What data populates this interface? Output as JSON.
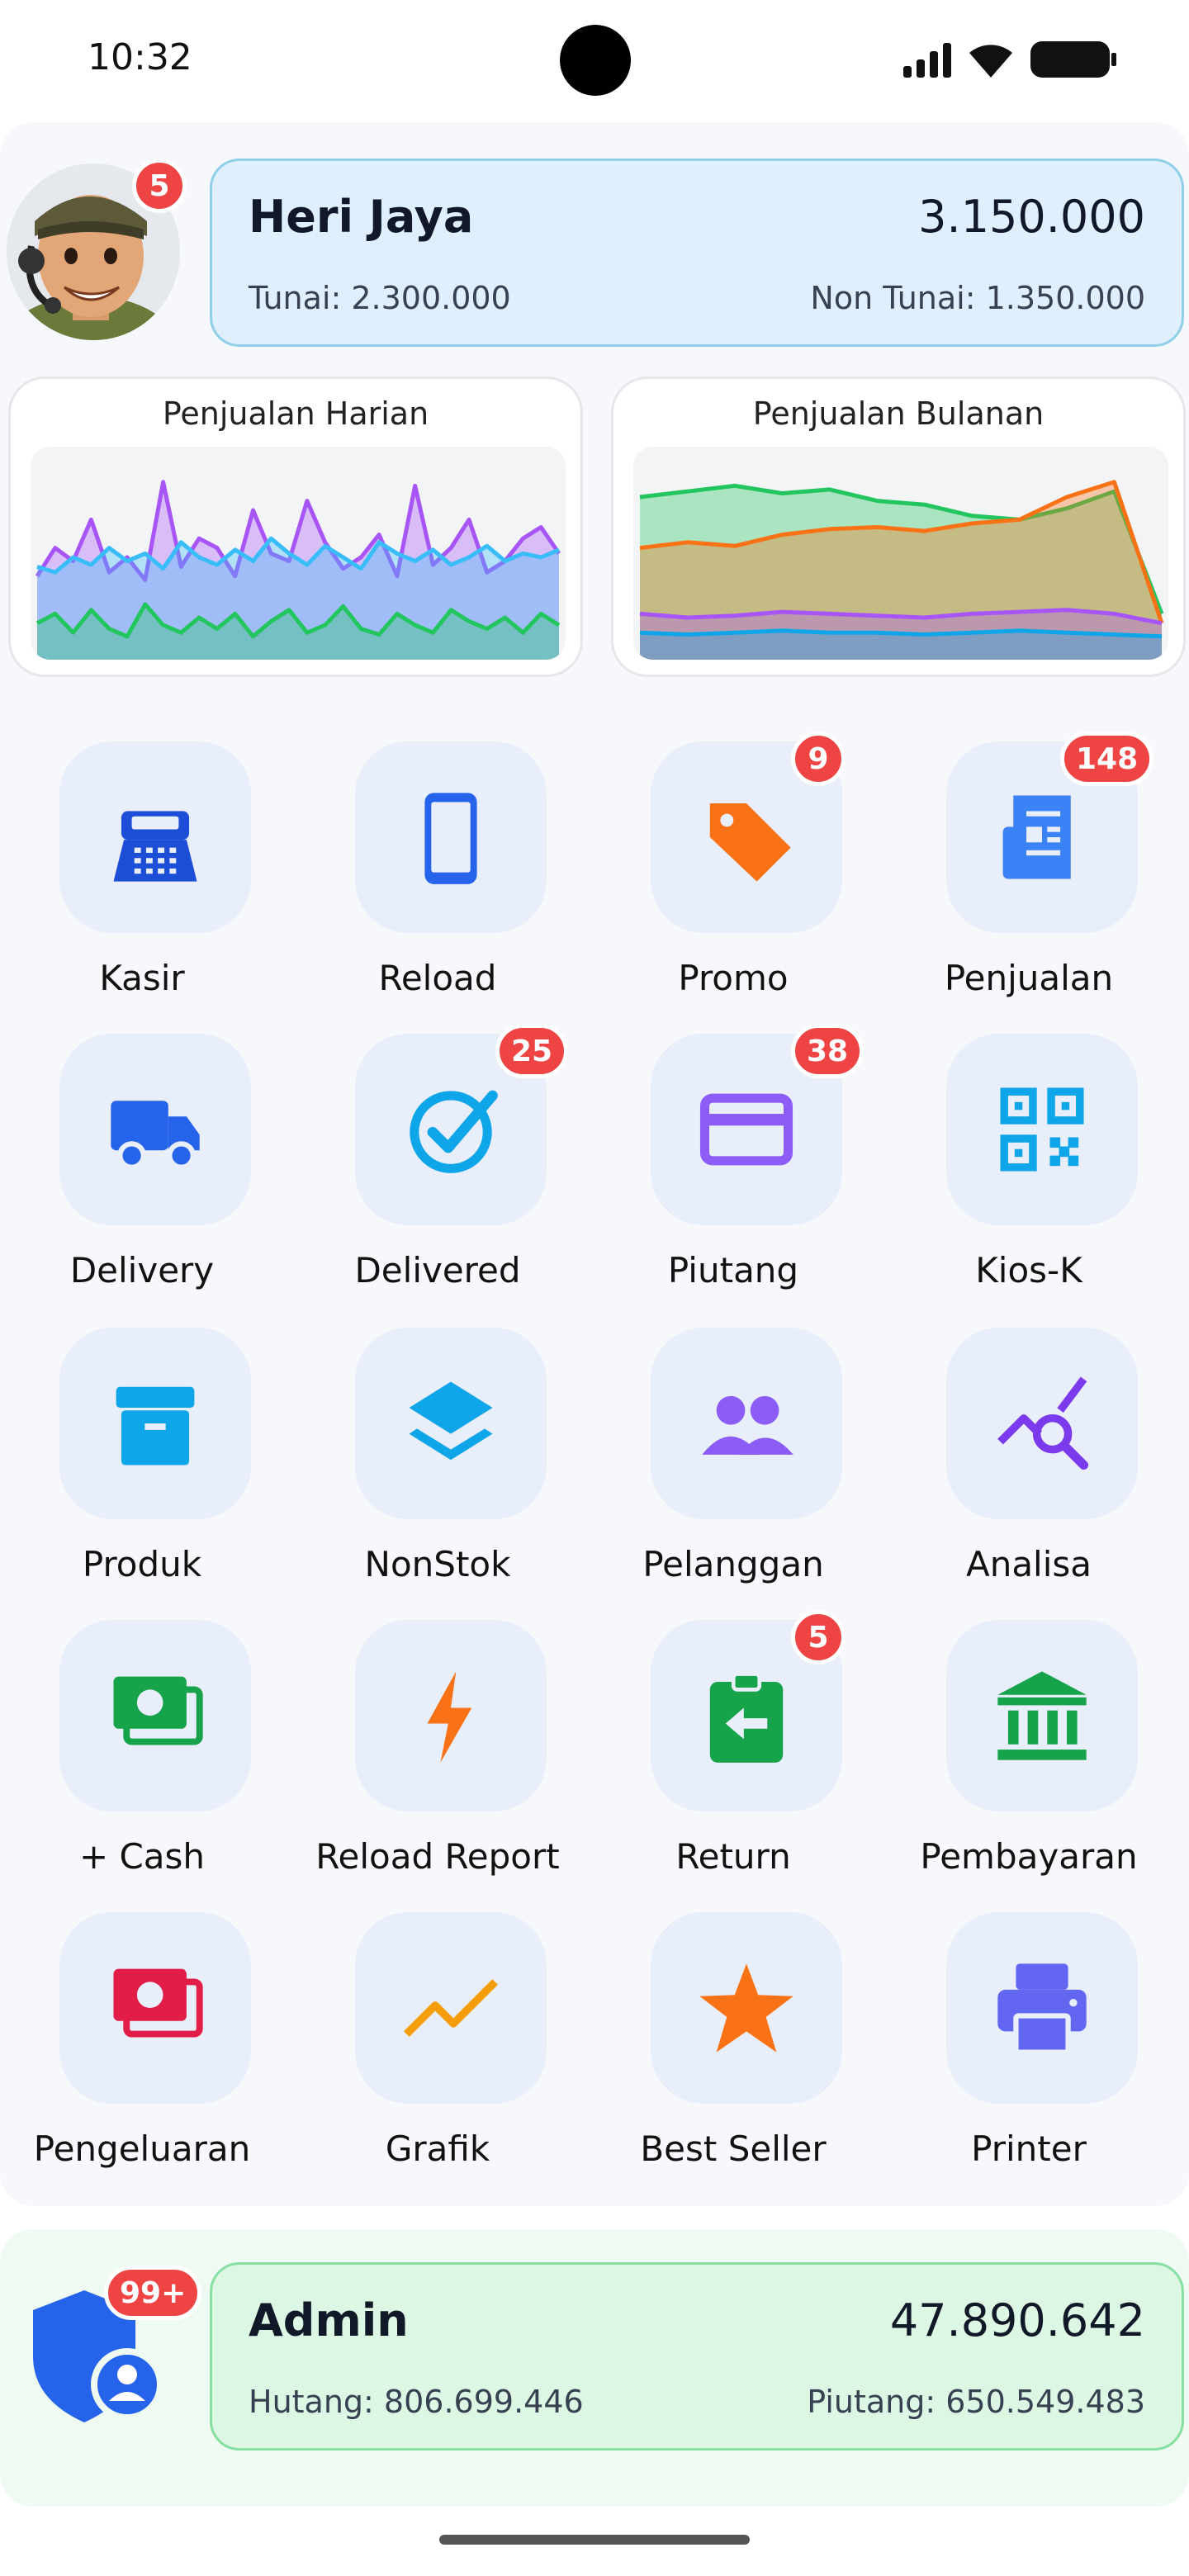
{
  "status_bar": {
    "time": "10:32"
  },
  "user": {
    "name": "Heri Jaya",
    "badge": "5",
    "total": "3.150.000",
    "tunai": "Tunai: 2.300.000",
    "non_tunai": "Non Tunai: 1.350.000"
  },
  "charts": {
    "daily_title": "Penjualan Harian",
    "monthly_title": "Penjualan Bulanan"
  },
  "chart_data": [
    {
      "type": "area",
      "title": "Penjualan Harian",
      "x": [
        1,
        2,
        3,
        4,
        5,
        6,
        7,
        8,
        9,
        10,
        11,
        12,
        13,
        14,
        15,
        16,
        17,
        18,
        19,
        20,
        21,
        22,
        23,
        24,
        25,
        26,
        27,
        28,
        29,
        30
      ],
      "series": [
        {
          "color": "#a855f7",
          "values": [
            40,
            55,
            48,
            70,
            42,
            50,
            38,
            90,
            45,
            60,
            55,
            40,
            75,
            52,
            48,
            80,
            58,
            44,
            50,
            62,
            40,
            88,
            46,
            55,
            70,
            42,
            48,
            60,
            66,
            52
          ]
        },
        {
          "color": "#38bdf8",
          "values": [
            45,
            42,
            50,
            46,
            55,
            48,
            52,
            44,
            58,
            50,
            46,
            54,
            48,
            60,
            52,
            46,
            56,
            50,
            44,
            58,
            52,
            48,
            54,
            46,
            50,
            56,
            48,
            52,
            50,
            54
          ]
        },
        {
          "color": "#22c55e",
          "values": [
            15,
            20,
            10,
            22,
            12,
            8,
            25,
            14,
            10,
            18,
            12,
            20,
            8,
            16,
            22,
            10,
            14,
            24,
            12,
            9,
            20,
            14,
            10,
            22,
            16,
            12,
            18,
            10,
            20,
            14
          ]
        }
      ]
    },
    {
      "type": "area",
      "title": "Penjualan Bulanan",
      "x": [
        1,
        2,
        3,
        4,
        5,
        6,
        7,
        8,
        9,
        10,
        11,
        12
      ],
      "series": [
        {
          "color": "#22c55e",
          "values": [
            82,
            85,
            88,
            84,
            86,
            80,
            78,
            72,
            70,
            76,
            85,
            20
          ]
        },
        {
          "color": "#f97316",
          "values": [
            55,
            58,
            56,
            62,
            65,
            66,
            64,
            68,
            70,
            82,
            90,
            15
          ]
        },
        {
          "color": "#a855f7",
          "values": [
            20,
            18,
            19,
            21,
            20,
            19,
            18,
            20,
            21,
            22,
            20,
            15
          ]
        },
        {
          "color": "#0ea5e9",
          "values": [
            10,
            9,
            10,
            11,
            10,
            10,
            9,
            10,
            11,
            10,
            9,
            8
          ]
        }
      ]
    }
  ],
  "menu": [
    {
      "label": "Kasir",
      "icon": "cash-register-icon",
      "color": "#1d4ed8",
      "badge": ""
    },
    {
      "label": "Reload",
      "icon": "phone-icon",
      "color": "#2563eb",
      "badge": ""
    },
    {
      "label": "Promo",
      "icon": "tag-icon",
      "color": "#f97316",
      "badge": "9"
    },
    {
      "label": "Penjualan",
      "icon": "receipt-icon",
      "color": "#3b82f6",
      "badge": "148"
    },
    {
      "label": "Delivery",
      "icon": "truck-icon",
      "color": "#2563eb",
      "badge": ""
    },
    {
      "label": "Delivered",
      "icon": "check-circle-icon",
      "color": "#0ea5e9",
      "badge": "25"
    },
    {
      "label": "Piutang",
      "icon": "credit-card-icon",
      "color": "#8b5cf6",
      "badge": "38"
    },
    {
      "label": "Kios-K",
      "icon": "qr-code-icon",
      "color": "#0ea5e9",
      "badge": ""
    },
    {
      "label": "Produk",
      "icon": "archive-box-icon",
      "color": "#0ea5e9",
      "badge": ""
    },
    {
      "label": "NonStok",
      "icon": "layers-icon",
      "color": "#0ea5e9",
      "badge": ""
    },
    {
      "label": "Pelanggan",
      "icon": "users-icon",
      "color": "#8b5cf6",
      "badge": ""
    },
    {
      "label": "Analisa",
      "icon": "analytics-search-icon",
      "color": "#7c3aed",
      "badge": ""
    },
    {
      "label": "+ Cash",
      "icon": "money-icon",
      "color": "#16a34a",
      "badge": ""
    },
    {
      "label": "Reload Report",
      "icon": "bolt-icon",
      "color": "#f97316",
      "badge": ""
    },
    {
      "label": "Return",
      "icon": "return-clipboard-icon",
      "color": "#16a34a",
      "badge": "5"
    },
    {
      "label": "Pembayaran",
      "icon": "bank-icon",
      "color": "#16a34a",
      "badge": ""
    },
    {
      "label": "Pengeluaran",
      "icon": "money-out-icon",
      "color": "#e11d48",
      "badge": ""
    },
    {
      "label": "Grafik",
      "icon": "trend-line-icon",
      "color": "#f59e0b",
      "badge": ""
    },
    {
      "label": "Best Seller",
      "icon": "star-icon",
      "color": "#f97316",
      "badge": ""
    },
    {
      "label": "Printer",
      "icon": "printer-icon",
      "color": "#6366f1",
      "badge": ""
    }
  ],
  "admin": {
    "name": "Admin",
    "badge": "99+",
    "total": "47.890.642",
    "hutang": "Hutang: 806.699.446",
    "piutang": "Piutang: 650.549.483"
  }
}
